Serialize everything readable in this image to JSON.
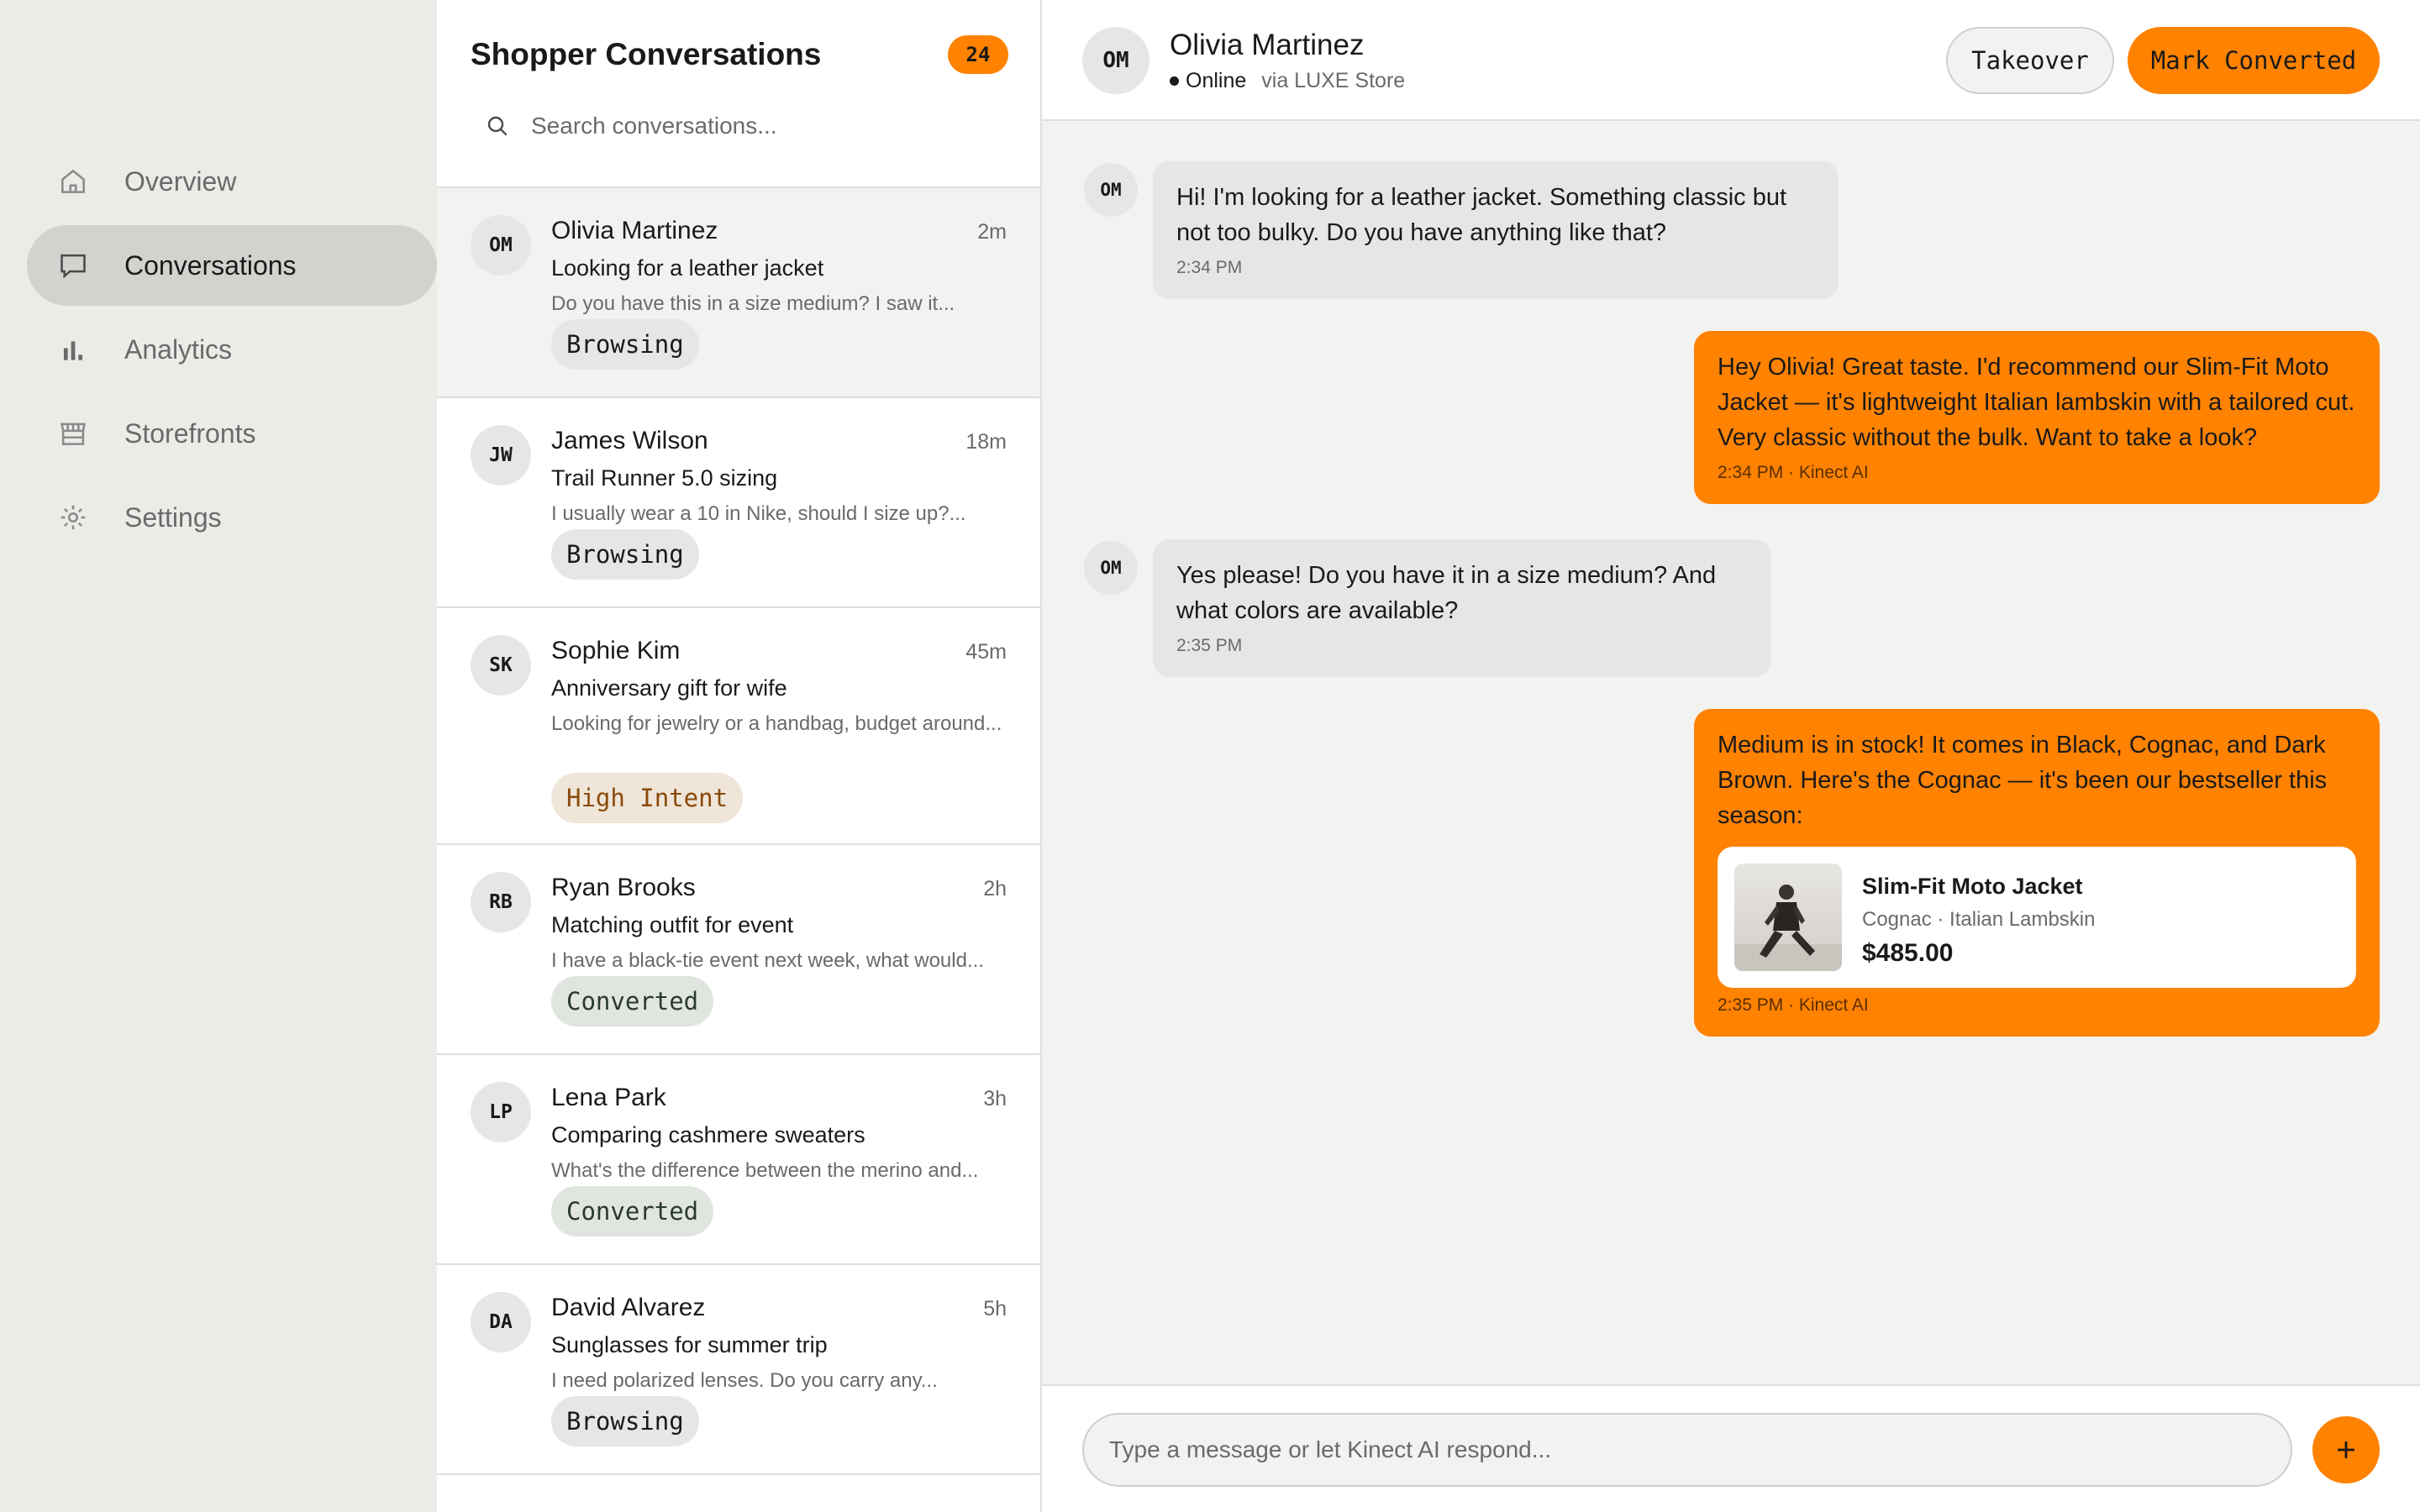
{
  "theme": {
    "accent": "#ff8200",
    "surface": "#ffffff",
    "background": "#ececea"
  },
  "sidebar": {
    "items": [
      {
        "label": "Overview",
        "icon": "home-icon",
        "active": false
      },
      {
        "label": "Conversations",
        "icon": "chat-bubble-icon",
        "active": true
      },
      {
        "label": "Analytics",
        "icon": "bar-chart-icon",
        "active": false
      },
      {
        "label": "Storefronts",
        "icon": "storefront-icon",
        "active": false
      },
      {
        "label": "Settings",
        "icon": "gear-icon",
        "active": false
      }
    ]
  },
  "list": {
    "title": "Shopper Conversations",
    "count": "24",
    "search_placeholder": "Search conversations...",
    "conversations": [
      {
        "initials": "OM",
        "name": "Olivia Martinez",
        "time": "2m",
        "subject": "Looking for a leather jacket",
        "preview": "Do you have this in a size medium? I saw it...",
        "tag": "Browsing"
      },
      {
        "initials": "JW",
        "name": "James Wilson",
        "time": "18m",
        "subject": "Trail Runner 5.0 sizing",
        "preview": "I usually wear a 10 in Nike, should I size up?...",
        "tag": "Browsing"
      },
      {
        "initials": "SK",
        "name": "Sophie Kim",
        "time": "45m",
        "subject": "Anniversary gift for wife",
        "preview": "Looking for jewelry or a handbag, budget around...",
        "tag": "High Intent"
      },
      {
        "initials": "RB",
        "name": "Ryan Brooks",
        "time": "2h",
        "subject": "Matching outfit for event",
        "preview": "I have a black-tie event next week, what would...",
        "tag": "Converted"
      },
      {
        "initials": "LP",
        "name": "Lena Park",
        "time": "3h",
        "subject": "Comparing cashmere sweaters",
        "preview": "What's the difference between the merino and...",
        "tag": "Converted"
      },
      {
        "initials": "DA",
        "name": "David Alvarez",
        "time": "5h",
        "subject": "Sunglasses for summer trip",
        "preview": "I need polarized lenses. Do you carry any...",
        "tag": "Browsing"
      }
    ]
  },
  "chat": {
    "initials": "OM",
    "name": "Olivia Martinez",
    "status": "Online",
    "via": "via LUXE Store",
    "takeover_label": "Takeover",
    "convert_label": "Mark Converted",
    "messages": [
      {
        "from": "shopper",
        "initials": "OM",
        "text": "Hi! I'm looking for a leather jacket. Something classic but not too bulky. Do you have anything like that?",
        "meta": "2:34 PM"
      },
      {
        "from": "ai",
        "text": "Hey Olivia! Great taste. I'd recommend our Slim-Fit Moto Jacket — it's lightweight Italian lambskin with a tailored cut. Very classic without the bulk. Want to take a look?",
        "meta": "2:34 PM · Kinect AI"
      },
      {
        "from": "shopper",
        "initials": "OM",
        "text": "Yes please! Do you have it in a size medium? And what colors are available?",
        "meta": "2:35 PM"
      },
      {
        "from": "ai",
        "text": "Medium is in stock! It comes in Black, Cognac, and Dark Brown. Here's the Cognac — it's been our bestseller this season:",
        "meta": "2:35 PM · Kinect AI"
      }
    ],
    "product": {
      "name": "Slim-Fit Moto Jacket",
      "variant": "Cognac · Italian Lambskin",
      "price": "$485.00"
    },
    "composer_placeholder": "Type a message or let Kinect AI respond..."
  }
}
